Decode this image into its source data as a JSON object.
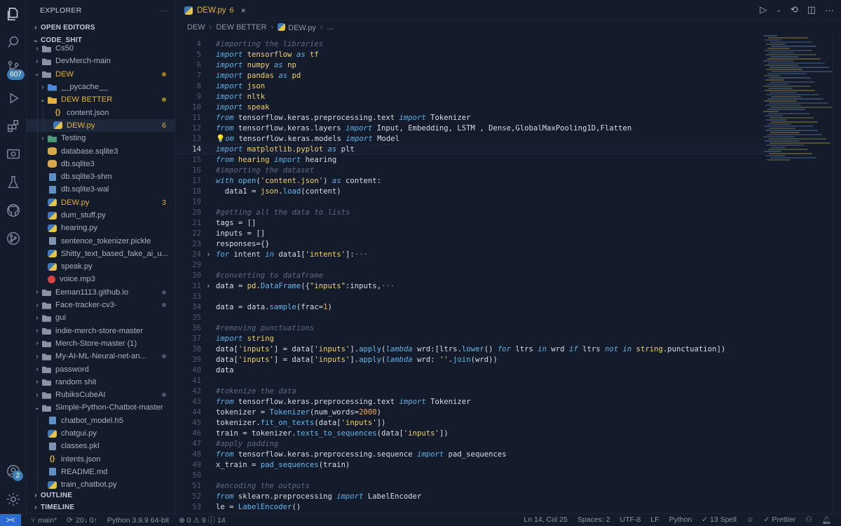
{
  "activity": {
    "scm_badge": "607",
    "account_badge": "2"
  },
  "sidebar": {
    "title": "EXPLORER",
    "more": "···",
    "open_editors": "OPEN EDITORS",
    "workspace": "CODE_SHIT",
    "outline": "OUTLINE",
    "timeline": "TIMELINE",
    "items": [
      {
        "name": "Cs50",
        "type": "folder",
        "depth": 1,
        "open": false,
        "partial": true
      },
      {
        "name": "DevMerch-main",
        "type": "folder",
        "depth": 1,
        "open": false
      },
      {
        "name": "DEW",
        "type": "folder",
        "depth": 1,
        "open": true,
        "modified": true,
        "dot": "y"
      },
      {
        "name": "__pycache__",
        "type": "folder-blue",
        "depth": 2,
        "open": false
      },
      {
        "name": "DEW BETTER",
        "type": "folder-yellow",
        "depth": 2,
        "open": true,
        "modified": true,
        "dot": "y"
      },
      {
        "name": "content.json",
        "type": "json",
        "depth": 3
      },
      {
        "name": "DEW.py",
        "type": "py",
        "depth": 3,
        "modified": true,
        "count": "6",
        "selected": true
      },
      {
        "name": "Testing",
        "type": "folder-green",
        "depth": 2,
        "open": false
      },
      {
        "name": "database.sqlite3",
        "type": "db",
        "depth": 2
      },
      {
        "name": "db.sqlite3",
        "type": "db",
        "depth": 2
      },
      {
        "name": "db.sqlite3-shm",
        "type": "gen",
        "depth": 2
      },
      {
        "name": "db.sqlite3-wal",
        "type": "gen",
        "depth": 2
      },
      {
        "name": "DEW.py",
        "type": "py",
        "depth": 2,
        "modified": true,
        "count": "3"
      },
      {
        "name": "dum_stuff.py",
        "type": "py",
        "depth": 2
      },
      {
        "name": "hearing.py",
        "type": "py",
        "depth": 2
      },
      {
        "name": "sentence_tokenizer.pickle",
        "type": "pkl",
        "depth": 2
      },
      {
        "name": "Shitty_text_based_fake_ai_u...",
        "type": "py",
        "depth": 2
      },
      {
        "name": "speak.py",
        "type": "py",
        "depth": 2
      },
      {
        "name": "voice.mp3",
        "type": "mp3",
        "depth": 2
      },
      {
        "name": "Eeman1113.github.io",
        "type": "folder",
        "depth": 1,
        "open": false,
        "dot": "g"
      },
      {
        "name": "Face-tracker-cv3-",
        "type": "folder",
        "depth": 1,
        "open": false,
        "dot": "g"
      },
      {
        "name": "gui",
        "type": "folder",
        "depth": 1,
        "open": false
      },
      {
        "name": "indie-merch-store-master",
        "type": "folder",
        "depth": 1,
        "open": false
      },
      {
        "name": "Merch-Store-master (1)",
        "type": "folder",
        "depth": 1,
        "open": false
      },
      {
        "name": "My-AI-ML-Neural-net-an...",
        "type": "folder",
        "depth": 1,
        "open": false,
        "dot": "g"
      },
      {
        "name": "password",
        "type": "folder",
        "depth": 1,
        "open": false
      },
      {
        "name": "random shit",
        "type": "folder",
        "depth": 1,
        "open": false
      },
      {
        "name": "RubiksCubeAI",
        "type": "folder",
        "depth": 1,
        "open": false,
        "dot": "g"
      },
      {
        "name": "Simple-Python-Chatbot-master",
        "type": "folder",
        "depth": 1,
        "open": true
      },
      {
        "name": "chatbot_model.h5",
        "type": "gen",
        "depth": 2
      },
      {
        "name": "chatgui.py",
        "type": "py",
        "depth": 2
      },
      {
        "name": "classes.pkl",
        "type": "pkl",
        "depth": 2
      },
      {
        "name": "intents.json",
        "type": "json",
        "depth": 2
      },
      {
        "name": "README.md",
        "type": "gen",
        "depth": 2
      },
      {
        "name": "train_chatbot.py",
        "type": "py",
        "depth": 2,
        "partial": true
      }
    ]
  },
  "tab": {
    "label": "DEW.py",
    "count": "6",
    "close": "×"
  },
  "breadcrumb": [
    "DEW",
    "DEW BETTER",
    "DEW.py",
    "..."
  ],
  "code": [
    {
      "n": "4",
      "t": [
        [
          "cm",
          "#importing the libraries"
        ]
      ]
    },
    {
      "n": "5",
      "t": [
        [
          "kw",
          "import "
        ],
        [
          "mod",
          "tensorflow"
        ],
        [
          "kw",
          " as "
        ],
        [
          "mod",
          "tf"
        ]
      ]
    },
    {
      "n": "6",
      "t": [
        [
          "kw",
          "import "
        ],
        [
          "mod",
          "numpy"
        ],
        [
          "kw",
          " as "
        ],
        [
          "mod",
          "np"
        ]
      ]
    },
    {
      "n": "7",
      "t": [
        [
          "kw",
          "import "
        ],
        [
          "mod",
          "pandas"
        ],
        [
          "kw",
          " as "
        ],
        [
          "mod",
          "pd"
        ]
      ]
    },
    {
      "n": "8",
      "t": [
        [
          "kw",
          "import "
        ],
        [
          "mod",
          "json"
        ]
      ]
    },
    {
      "n": "9",
      "t": [
        [
          "kw",
          "import "
        ],
        [
          "mod",
          "nltk"
        ]
      ]
    },
    {
      "n": "10",
      "t": [
        [
          "kw",
          "import "
        ],
        [
          "mod",
          "speak"
        ]
      ]
    },
    {
      "n": "11",
      "t": [
        [
          "kw",
          "from "
        ],
        [
          "bl",
          "tensorflow.keras.preprocessing.text"
        ],
        [
          "kw",
          " import "
        ],
        [
          "bl",
          "Tokenizer"
        ]
      ]
    },
    {
      "n": "12",
      "t": [
        [
          "kw",
          "from "
        ],
        [
          "bl",
          "tensorflow.keras.layers"
        ],
        [
          "kw",
          " import "
        ],
        [
          "bl",
          "Input, Embedding, LSTM , Dense,GlobalMaxPooling1D,Flatten"
        ]
      ]
    },
    {
      "n": "13",
      "bulb": "💡",
      "t": [
        [
          "kw",
          "om "
        ],
        [
          "bl",
          "tensorflow.keras.models"
        ],
        [
          "kw",
          " import "
        ],
        [
          "bl",
          "Model"
        ]
      ]
    },
    {
      "n": "14",
      "cur": true,
      "t": [
        [
          "kw",
          "import "
        ],
        [
          "mod",
          "matplotlib.pyplot"
        ],
        [
          "kw",
          " as "
        ],
        [
          "bl",
          "plt"
        ]
      ]
    },
    {
      "n": "15",
      "t": [
        [
          "kw",
          "from "
        ],
        [
          "mod",
          "hearing"
        ],
        [
          "kw",
          " import "
        ],
        [
          "bl",
          "hearing"
        ]
      ]
    },
    {
      "n": "16",
      "t": [
        [
          "cm",
          "#importing the dataset"
        ]
      ]
    },
    {
      "n": "17",
      "t": [
        [
          "kw",
          "with "
        ],
        [
          "fn",
          "open"
        ],
        [
          "bl",
          "("
        ],
        [
          "str",
          "'content.json'"
        ],
        [
          "bl",
          ")"
        ],
        [
          "kw",
          " as "
        ],
        [
          "bl",
          "content:"
        ]
      ]
    },
    {
      "n": "18",
      "t": [
        [
          "bl",
          "  data1 = "
        ],
        [
          "mod",
          "json"
        ],
        [
          "bl",
          "."
        ],
        [
          "fn",
          "load"
        ],
        [
          "bl",
          "(content)"
        ]
      ]
    },
    {
      "n": "19",
      "t": []
    },
    {
      "n": "20",
      "t": [
        [
          "cm",
          "#getting all the data to lists"
        ]
      ]
    },
    {
      "n": "21",
      "t": [
        [
          "bl",
          "tags = []"
        ]
      ]
    },
    {
      "n": "22",
      "t": [
        [
          "bl",
          "inputs = []"
        ]
      ]
    },
    {
      "n": "23",
      "t": [
        [
          "bl",
          "responses={}"
        ]
      ]
    },
    {
      "n": "24",
      "fold": "›",
      "t": [
        [
          "kw",
          "for "
        ],
        [
          "bl",
          "intent "
        ],
        [
          "kw",
          "in "
        ],
        [
          "bl",
          "data1["
        ],
        [
          "str",
          "'intents'"
        ],
        [
          "bl",
          "]:"
        ],
        [
          "fe",
          "···"
        ]
      ]
    },
    {
      "n": "29",
      "t": []
    },
    {
      "n": "30",
      "t": [
        [
          "cm",
          "#converting to dataframe"
        ]
      ]
    },
    {
      "n": "31",
      "fold": "›",
      "t": [
        [
          "bl",
          "data = "
        ],
        [
          "mod",
          "pd"
        ],
        [
          "bl",
          "."
        ],
        [
          "fn",
          "DataFrame"
        ],
        [
          "bl",
          "({"
        ],
        [
          "str",
          "\"inputs\""
        ],
        [
          "bl",
          ":inputs,"
        ],
        [
          "fe",
          "···"
        ]
      ]
    },
    {
      "n": "33",
      "t": []
    },
    {
      "n": "34",
      "t": [
        [
          "bl",
          "data = data."
        ],
        [
          "fn",
          "sample"
        ],
        [
          "bl",
          "(frac="
        ],
        [
          "num",
          "1"
        ],
        [
          "bl",
          ")"
        ]
      ]
    },
    {
      "n": "35",
      "t": []
    },
    {
      "n": "36",
      "t": [
        [
          "cm",
          "#removing punctuations"
        ]
      ]
    },
    {
      "n": "37",
      "t": [
        [
          "kw",
          "import "
        ],
        [
          "mod",
          "string"
        ]
      ]
    },
    {
      "n": "38",
      "t": [
        [
          "bl",
          "data["
        ],
        [
          "str",
          "'inputs'"
        ],
        [
          "bl",
          "] = data["
        ],
        [
          "str",
          "'inputs'"
        ],
        [
          "bl",
          "]."
        ],
        [
          "fn",
          "apply"
        ],
        [
          "bl",
          "("
        ],
        [
          "kw",
          "lambda "
        ],
        [
          "bl",
          "wrd:[ltrs."
        ],
        [
          "fn",
          "lower"
        ],
        [
          "bl",
          "() "
        ],
        [
          "kw",
          "for "
        ],
        [
          "bl",
          "ltrs "
        ],
        [
          "kw",
          "in "
        ],
        [
          "bl",
          "wrd "
        ],
        [
          "kw",
          "if "
        ],
        [
          "bl",
          "ltrs "
        ],
        [
          "kw",
          "not in "
        ],
        [
          "mod",
          "string"
        ],
        [
          "bl",
          ".punctuation])"
        ]
      ]
    },
    {
      "n": "39",
      "t": [
        [
          "bl",
          "data["
        ],
        [
          "str",
          "'inputs'"
        ],
        [
          "bl",
          "] = data["
        ],
        [
          "str",
          "'inputs'"
        ],
        [
          "bl",
          "]."
        ],
        [
          "fn",
          "apply"
        ],
        [
          "bl",
          "("
        ],
        [
          "kw",
          "lambda "
        ],
        [
          "bl",
          "wrd: "
        ],
        [
          "str",
          "''"
        ],
        [
          "bl",
          "."
        ],
        [
          "fn",
          "join"
        ],
        [
          "bl",
          "(wrd))"
        ]
      ]
    },
    {
      "n": "40",
      "t": [
        [
          "bl",
          "data"
        ]
      ]
    },
    {
      "n": "41",
      "t": []
    },
    {
      "n": "42",
      "t": [
        [
          "cm",
          "#tokenize the data"
        ]
      ]
    },
    {
      "n": "43",
      "t": [
        [
          "kw",
          "from "
        ],
        [
          "bl",
          "tensorflow.keras.preprocessing.text"
        ],
        [
          "kw",
          " import "
        ],
        [
          "bl",
          "Tokenizer"
        ]
      ]
    },
    {
      "n": "44",
      "t": [
        [
          "bl",
          "tokenizer = "
        ],
        [
          "fn",
          "Tokenizer"
        ],
        [
          "bl",
          "(num_words="
        ],
        [
          "num",
          "2000"
        ],
        [
          "bl",
          ")"
        ]
      ]
    },
    {
      "n": "45",
      "t": [
        [
          "bl",
          "tokenizer."
        ],
        [
          "fn",
          "fit_on_texts"
        ],
        [
          "bl",
          "(data["
        ],
        [
          "str",
          "'inputs'"
        ],
        [
          "bl",
          "])"
        ]
      ]
    },
    {
      "n": "46",
      "t": [
        [
          "bl",
          "train = tokenizer."
        ],
        [
          "fn",
          "texts_to_sequences"
        ],
        [
          "bl",
          "(data["
        ],
        [
          "str",
          "'inputs'"
        ],
        [
          "bl",
          "])"
        ]
      ]
    },
    {
      "n": "47",
      "t": [
        [
          "cm",
          "#apply padding"
        ]
      ]
    },
    {
      "n": "48",
      "t": [
        [
          "kw",
          "from "
        ],
        [
          "bl",
          "tensorflow.keras.preprocessing.sequence"
        ],
        [
          "kw",
          " import "
        ],
        [
          "bl",
          "pad_sequences"
        ]
      ]
    },
    {
      "n": "49",
      "t": [
        [
          "bl",
          "x_train = "
        ],
        [
          "fn",
          "pad_sequences"
        ],
        [
          "bl",
          "(train)"
        ]
      ]
    },
    {
      "n": "50",
      "t": []
    },
    {
      "n": "51",
      "t": [
        [
          "cm",
          "#encoding the outputs"
        ]
      ]
    },
    {
      "n": "52",
      "t": [
        [
          "kw",
          "from "
        ],
        [
          "bl",
          "sklearn.preprocessing"
        ],
        [
          "kw",
          " import "
        ],
        [
          "bl",
          "LabelEncoder"
        ]
      ]
    },
    {
      "n": "53",
      "t": [
        [
          "bl",
          "le = "
        ],
        [
          "fn",
          "LabelEncoder"
        ],
        [
          "bl",
          "()"
        ]
      ]
    }
  ],
  "status": {
    "remote": "><",
    "branch": "main*",
    "sync": "20↓ 0↑",
    "python": "Python 3.9.9 64-bit",
    "problems": "⊗ 0 ⚠ 9 ⓘ 14",
    "position": "Ln 14, Col 25",
    "spaces": "Spaces: 2",
    "encoding": "UTF-8",
    "eol": "LF",
    "language": "Python",
    "spell": "✓ 13 Spell",
    "prettier": "✓ Prettier"
  }
}
